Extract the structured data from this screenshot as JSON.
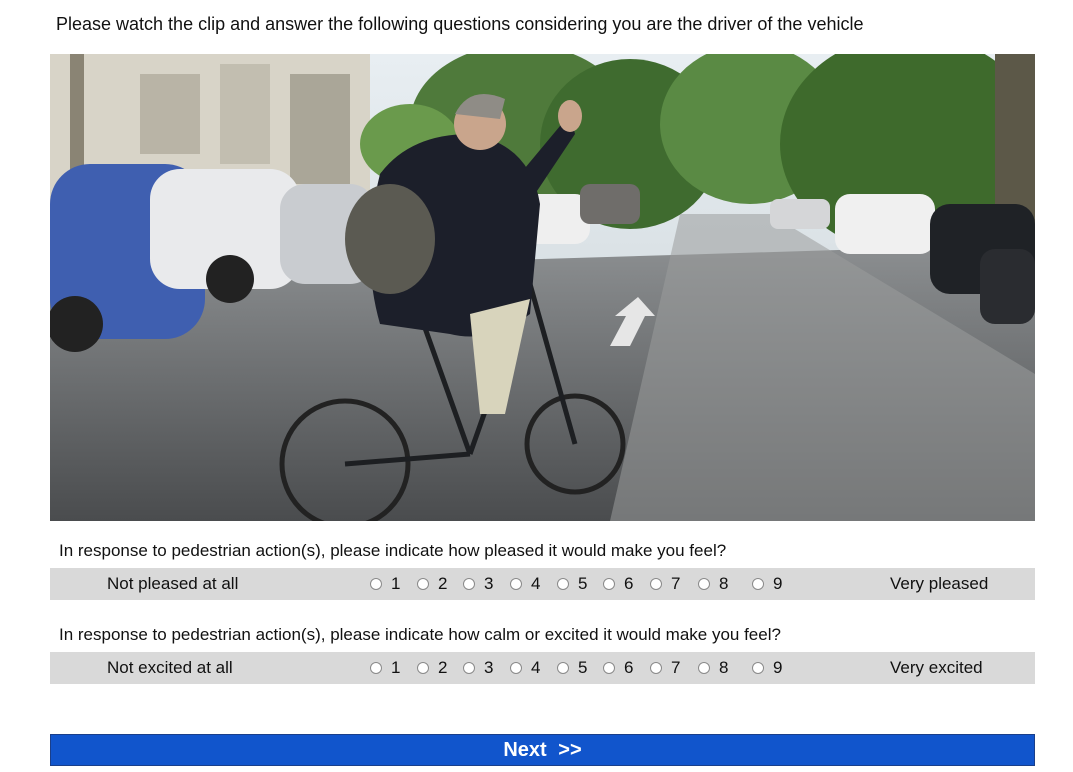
{
  "instruction": "Please watch the clip and answer the following questions considering you are the driver of the vehicle",
  "questions": [
    {
      "text": "In response to pedestrian action(s), please indicate how pleased  it would make you feel?",
      "low_anchor": "Not pleased at all",
      "high_anchor": "Very pleased",
      "options": [
        "1",
        "2",
        "3",
        "4",
        "5",
        "6",
        "7",
        "8",
        "9"
      ]
    },
    {
      "text": "In response to pedestrian action(s), please indicate how calm or excited it would make you feel?",
      "low_anchor": "Not excited at all",
      "high_anchor": "Very excited",
      "options": [
        "1",
        "2",
        "3",
        "4",
        "5",
        "6",
        "7",
        "8",
        "9"
      ]
    }
  ],
  "next_button": "Next  >>",
  "colors": {
    "scale_row_bg": "#d9d9d9",
    "next_button_bg": "#1155cc"
  }
}
